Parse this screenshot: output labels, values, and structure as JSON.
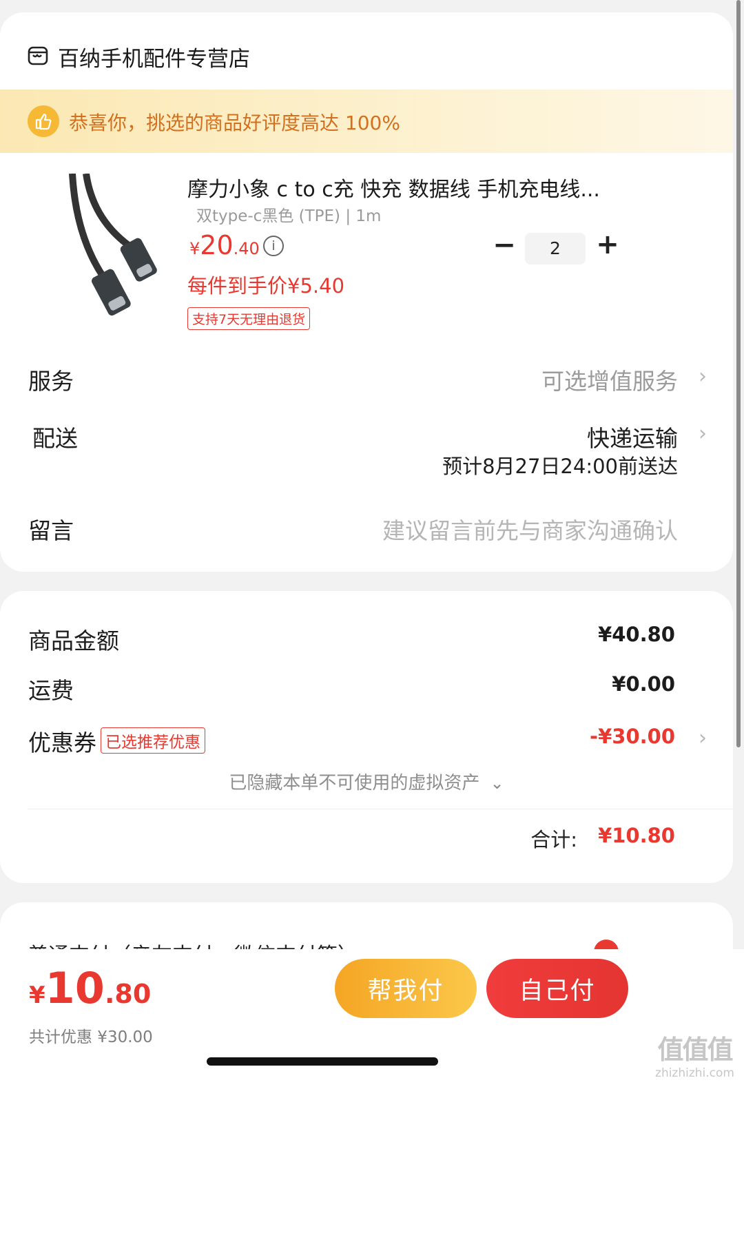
{
  "store": {
    "icon": "store-icon",
    "name": "百纳手机配件专营店"
  },
  "banner": {
    "icon": "thumbs-up-icon",
    "text": "恭喜你，挑选的商品好评度高达 100%"
  },
  "product": {
    "title": "摩力小象 c to c充 快充 数据线 手机充电线...",
    "spec": "双type-c黑色 (TPE) | 1m",
    "currency": "¥",
    "price_int": "20",
    "price_dec": ".40",
    "unit_price": "每件到手价¥5.40",
    "return_tag": "支持7天无理由退货",
    "quantity": "2",
    "minus": "−",
    "plus": "+"
  },
  "service": {
    "label": "服务",
    "value": "可选增值服务"
  },
  "delivery": {
    "label": "配送",
    "method": "快递运输",
    "eta": "预计8月27日24:00前送达"
  },
  "message": {
    "label": "留言",
    "placeholder": "建议留言前先与商家沟通确认"
  },
  "summary": {
    "goods_label": "商品金额",
    "goods_value": "¥40.80",
    "shipping_label": "运费",
    "shipping_value": "¥0.00",
    "coupon_label": "优惠券",
    "coupon_badge": "已选推荐优惠",
    "coupon_value": "-¥30.00",
    "hidden_assets": "已隐藏本单不可使用的虚拟资产",
    "total_label": "合计:",
    "total_value": "¥10.80"
  },
  "payment": {
    "partial_text": "普通支付（亲友支付、微信支付等）"
  },
  "bottom_bar": {
    "currency": "¥",
    "amount_int": "10",
    "amount_dec": ".80",
    "discount": "共计优惠 ¥30.00",
    "help_pay": "帮我付",
    "self_pay": "自己付"
  },
  "watermark": {
    "logo_text": "值值值",
    "url": "zhizhizhi.com"
  },
  "colors": {
    "accent_red": "#e8382f",
    "banner_bg": "#fcefc4",
    "banner_text": "#d4701d",
    "help_pay": "#f7b733",
    "self_pay": "#e93a36"
  }
}
